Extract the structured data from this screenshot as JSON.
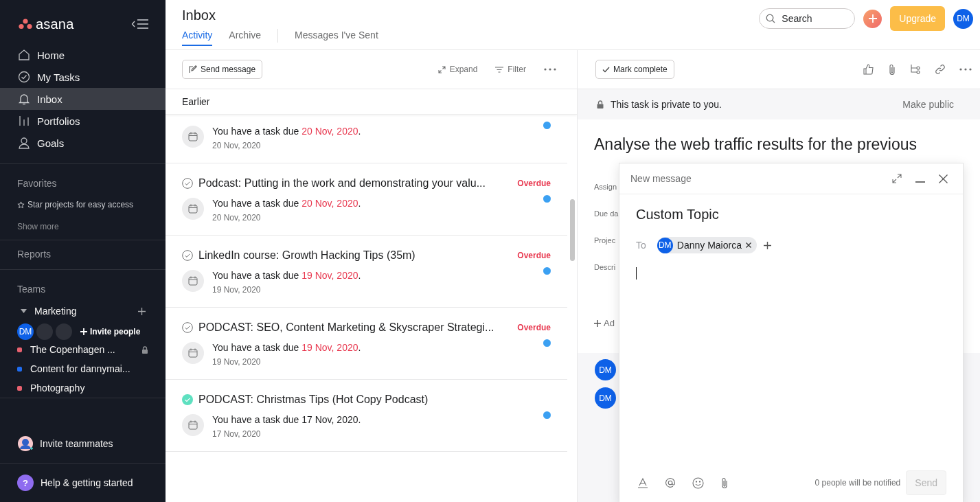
{
  "sidebar": {
    "logo": "asana",
    "nav": [
      {
        "label": "Home",
        "kind": "home",
        "selected": false
      },
      {
        "label": "My Tasks",
        "kind": "tasks",
        "selected": false
      },
      {
        "label": "Inbox",
        "kind": "inbox",
        "selected": true
      },
      {
        "label": "Portfolios",
        "kind": "portfolios",
        "selected": false
      },
      {
        "label": "Goals",
        "kind": "goals",
        "selected": false
      }
    ],
    "favorites": {
      "heading": "Favorites",
      "hint": "Star projects for easy access",
      "more": "Show more"
    },
    "reports": "Reports",
    "teams": {
      "heading": "Teams",
      "team": {
        "name": "Marketing",
        "expanded": true,
        "members": [
          {
            "kind": "initials",
            "initials": "DM"
          },
          {
            "kind": "blank"
          },
          {
            "kind": "blank"
          }
        ],
        "invite": "Invite people",
        "projects": [
          {
            "name": "The Copenhagen ...",
            "color": "#e8616f",
            "private": true
          },
          {
            "name": "Content for dannymai...",
            "color": "#1f6cf0",
            "private": false
          },
          {
            "name": "Photography",
            "color": "#e8616f",
            "private": false
          }
        ]
      }
    },
    "invite_teammates": "Invite teammates",
    "help": {
      "icon": "?",
      "label": "Help & getting started"
    }
  },
  "header": {
    "title": "Inbox",
    "tabs": [
      {
        "label": "Activity",
        "selected": true
      },
      {
        "label": "Archive",
        "selected": false
      },
      {
        "label": "Messages I've Sent",
        "selected": false
      }
    ],
    "search": {
      "placeholder": "Search"
    },
    "upgrade": "Upgrade",
    "avatar": "DM"
  },
  "inbox": {
    "toolbar": {
      "send": "Send message",
      "expand": "Expand",
      "filter": "Filter"
    },
    "section": "Earlier",
    "items": [
      {
        "notice": "You have a task due",
        "due_date": "20 Nov, 2020",
        "notice_end": ".",
        "date": "20 Nov, 2020",
        "overdue": true,
        "unread": true
      },
      {
        "title": "Podcast: Putting in the work and demonstrating your valu...",
        "completed": false,
        "status": "Overdue",
        "notice": "You have a task due",
        "due_date": "20 Nov, 2020",
        "notice_end": ".",
        "date": "20 Nov, 2020",
        "overdue": true,
        "unread": true
      },
      {
        "title": "LinkedIn course: Growth Hacking Tips (35m)",
        "completed": false,
        "status": "Overdue",
        "notice": "You have a task due",
        "due_date": "19 Nov, 2020",
        "notice_end": ".",
        "date": "19 Nov, 2020",
        "overdue": true,
        "unread": true
      },
      {
        "title": "PODCAST: SEO, Content Marketing & Skyscraper Strategi...",
        "completed": false,
        "status": "Overdue",
        "notice": "You have a task due",
        "due_date": "19 Nov, 2020",
        "notice_end": ".",
        "date": "19 Nov, 2020",
        "overdue": true,
        "unread": true
      },
      {
        "title": "PODCAST: Christmas Tips (Hot Copy Podcast)",
        "completed": true,
        "notice": "You have a task due",
        "due_date": "17 Nov, 2020",
        "notice_end": ".",
        "date": "17 Nov, 2020",
        "overdue": false,
        "unread": true
      }
    ]
  },
  "task": {
    "mark_complete": "Mark complete",
    "privacy": "This task is private to you.",
    "make_public": "Make public",
    "title": "Analyse the web traffic results for the previous",
    "fields": [
      "Assign",
      "Due da",
      "Projec",
      "Descri"
    ],
    "add": "Ad",
    "comment_avatars": [
      "DM",
      "DM"
    ]
  },
  "dialog": {
    "title": "New message",
    "topic": "Custom Topic",
    "to_label": "To",
    "recipients": [
      {
        "initials": "DM",
        "name": "Danny Maiorca"
      }
    ],
    "notify": "0 people will be notified",
    "send": "Send",
    "send_disabled": true
  }
}
